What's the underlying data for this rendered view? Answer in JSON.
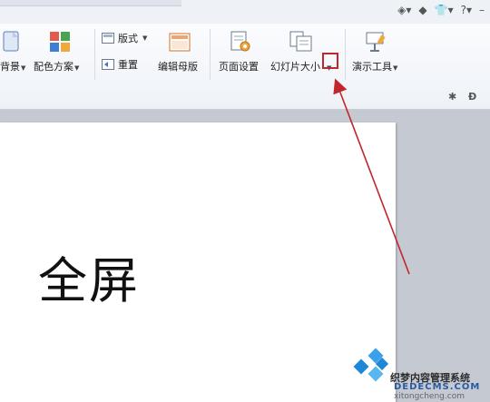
{
  "ribbon": {
    "background_label": "背景",
    "color_scheme_label": "配色方案",
    "layout_label": "版式",
    "reset_label": "重置",
    "edit_master_label": "编辑母版",
    "page_setup_label": "页面设置",
    "slide_size_label": "幻灯片大小",
    "presentation_tools_label": "演示工具"
  },
  "slide": {
    "text": "全屏"
  },
  "watermark": {
    "line1": "织梦内容管理系统",
    "line2": "DEDECMS.COM",
    "line3": "xitongcheng.com"
  },
  "colors": {
    "annotation": "#c0262b",
    "ribbon_bg": "#eef2f7",
    "workspace_bg": "#c5c9d1"
  }
}
